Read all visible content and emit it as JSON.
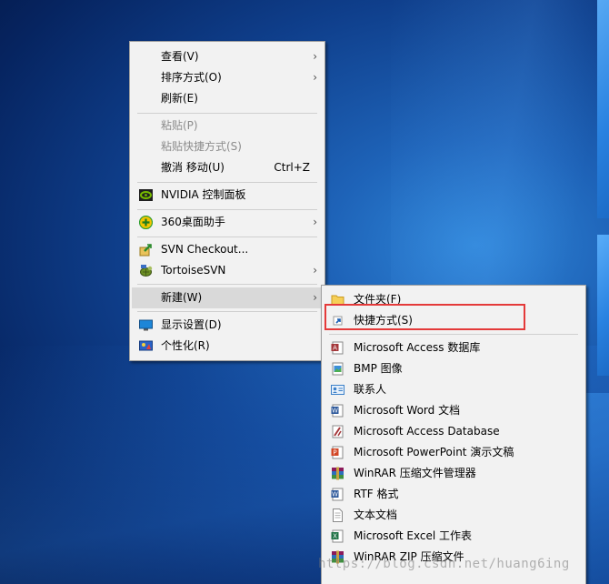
{
  "context_menu": {
    "items": [
      {
        "label": "查看(V)",
        "has_submenu": true
      },
      {
        "label": "排序方式(O)",
        "has_submenu": true
      },
      {
        "label": "刷新(E)"
      },
      {
        "label": "粘贴(P)",
        "disabled": true
      },
      {
        "label": "粘贴快捷方式(S)",
        "disabled": true
      },
      {
        "label": "撤消 移动(U)",
        "shortcut": "Ctrl+Z"
      },
      {
        "label": "NVIDIA 控制面板",
        "icon": "nvidia-icon"
      },
      {
        "label": "360桌面助手",
        "icon": "360-icon",
        "has_submenu": true
      },
      {
        "label": "SVN Checkout...",
        "icon": "svn-checkout-icon"
      },
      {
        "label": "TortoiseSVN",
        "icon": "tortoisesvn-icon",
        "has_submenu": true
      },
      {
        "label": "新建(W)",
        "has_submenu": true,
        "highlighted": true
      },
      {
        "label": "显示设置(D)",
        "icon": "display-settings-icon"
      },
      {
        "label": "个性化(R)",
        "icon": "personalize-icon"
      }
    ],
    "arrow_glyph": "›"
  },
  "new_submenu": {
    "items": [
      {
        "label": "文件夹(F)",
        "icon": "folder-icon"
      },
      {
        "label": "快捷方式(S)",
        "icon": "shortcut-icon"
      },
      {
        "label": "Microsoft Access 数据库",
        "icon": "access-icon"
      },
      {
        "label": "BMP 图像",
        "icon": "bmp-icon"
      },
      {
        "label": "联系人",
        "icon": "contact-icon"
      },
      {
        "label": "Microsoft Word 文档",
        "icon": "word-icon"
      },
      {
        "label": "Microsoft Access Database",
        "icon": "access-db-icon"
      },
      {
        "label": "Microsoft PowerPoint 演示文稿",
        "icon": "powerpoint-icon"
      },
      {
        "label": "WinRAR 压缩文件管理器",
        "icon": "winrar-icon"
      },
      {
        "label": "RTF 格式",
        "icon": "rtf-icon"
      },
      {
        "label": "文本文档",
        "icon": "text-document-icon"
      },
      {
        "label": "Microsoft Excel 工作表",
        "icon": "excel-icon"
      },
      {
        "label": "WinRAR ZIP 压缩文件",
        "icon": "winrar-zip-icon"
      }
    ]
  },
  "highlight_color": "#e43a3a",
  "watermark": "https://blog.csdn.net/huang6ing"
}
